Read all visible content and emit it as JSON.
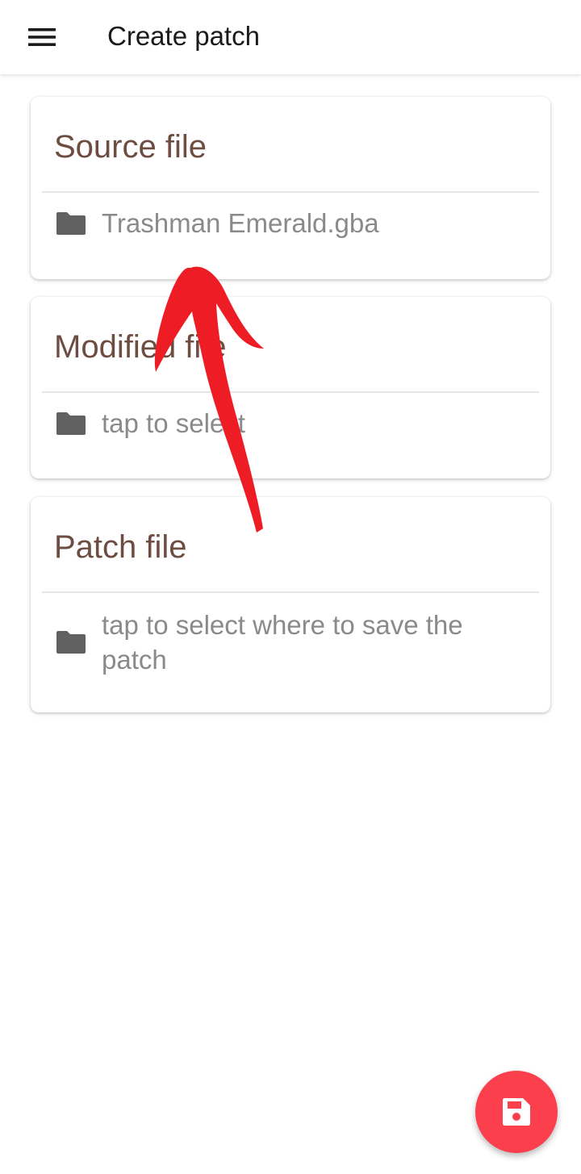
{
  "toolbar": {
    "title": "Create patch",
    "menu_icon": "hamburger-menu-icon"
  },
  "cards": [
    {
      "title": "Source file",
      "value": "Trashman Emerald.gba",
      "icon": "folder-icon"
    },
    {
      "title": "Modified file",
      "value": "tap to select",
      "icon": "folder-icon"
    },
    {
      "title": "Patch file",
      "value": "tap to select where to save the patch",
      "icon": "folder-icon"
    }
  ],
  "fab": {
    "icon": "save-icon"
  },
  "colors": {
    "card_title": "#6d4c41",
    "card_value": "#8a8a8a",
    "icon_gray": "#616161",
    "fab": "#fb3f4d",
    "annotation_arrow": "#ee1c24"
  }
}
